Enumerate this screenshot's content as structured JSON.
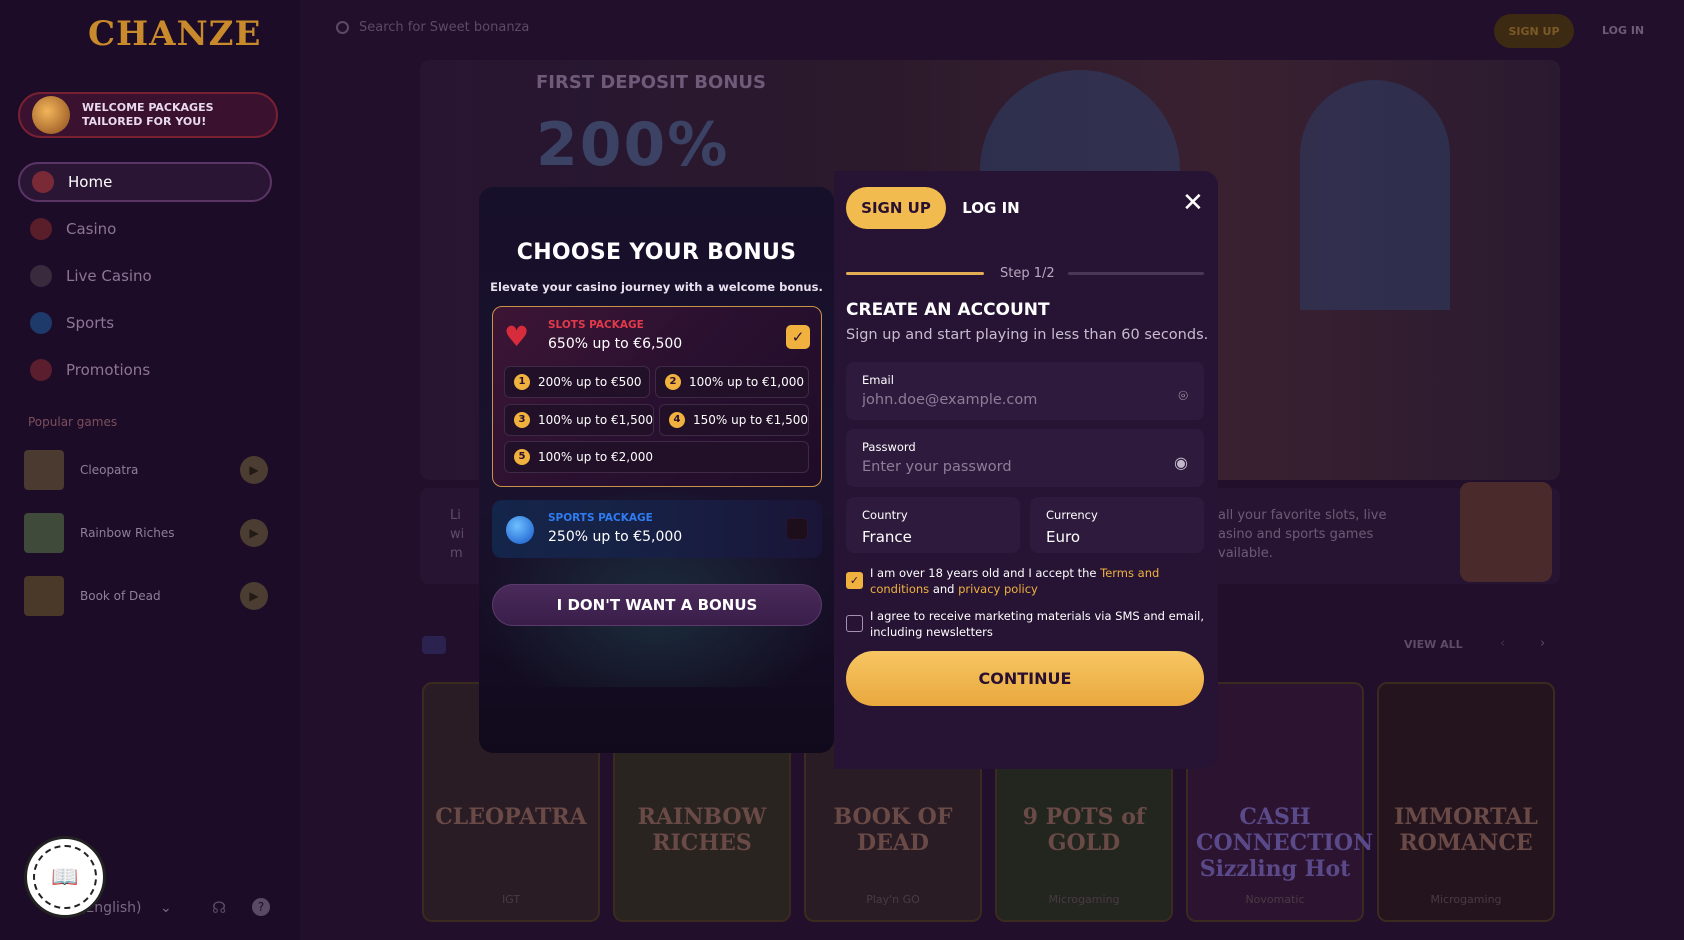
{
  "app": {
    "logo": "CHANZE",
    "search_placeholder": "Search for Sweet bonanza",
    "signup_label": "SIGN UP",
    "login_label": "LOG IN"
  },
  "sidebar": {
    "welcome_text": "WELCOME PACKAGES TAILORED FOR YOU!",
    "nav": [
      {
        "label": "Home"
      },
      {
        "label": "Casino"
      },
      {
        "label": "Live Casino"
      },
      {
        "label": "Sports"
      },
      {
        "label": "Promotions"
      }
    ],
    "popular_title": "Popular games",
    "popular_games": [
      {
        "name": "Cleopatra"
      },
      {
        "name": "Rainbow Riches"
      },
      {
        "name": "Book of Dead"
      }
    ],
    "language": "(English)"
  },
  "hero": {
    "title": "FIRST DEPOSIT BONUS",
    "big": "200%",
    "info_left": "Li\nwi\nm",
    "info_right": "all your favorite slots, live\nasino and sports games\nvailable."
  },
  "games_section": {
    "view_all": "VIEW ALL",
    "tiles": [
      {
        "name": "CLEOPATRA",
        "provider": "IGT"
      },
      {
        "name": "RAINBOW RICHES",
        "provider": ""
      },
      {
        "name": "BOOK OF DEAD",
        "provider": "Play'n GO"
      },
      {
        "name": "9 POTS of GOLD",
        "provider": "Microgaming"
      },
      {
        "name": "CASH CONNECTION Sizzling Hot",
        "provider": "Novomatic"
      },
      {
        "name": "IMMORTAL ROMANCE",
        "provider": "Microgaming"
      }
    ]
  },
  "bonus": {
    "title": "CHOOSE YOUR BONUS",
    "subtitle": "Elevate your casino journey with a welcome bonus.",
    "slots": {
      "label": "SLOTS PACKAGE",
      "value": "650% up to €6,500",
      "selected": true,
      "options": [
        {
          "num": "1",
          "text": "200% up to €500"
        },
        {
          "num": "2",
          "text": "100% up to €1,000"
        },
        {
          "num": "3",
          "text": "100% up to €1,500"
        },
        {
          "num": "4",
          "text": "150% up to €1,500"
        },
        {
          "num": "5",
          "text": "100% up to €2,000"
        }
      ]
    },
    "sports": {
      "label": "SPORTS PACKAGE",
      "value": "250% up to €5,000",
      "selected": false
    },
    "no_bonus_label": "I DON'T WANT A BONUS"
  },
  "auth": {
    "tab_signup": "SIGN UP",
    "tab_login": "LOG IN",
    "step": "Step 1/2",
    "progress": 0.5,
    "title": "CREATE AN ACCOUNT",
    "subtitle": "Sign up and start playing in less than 60 seconds.",
    "email_label": "Email",
    "email_placeholder": "john.doe@example.com",
    "password_label": "Password",
    "password_placeholder": "Enter your password",
    "country_label": "Country",
    "country_value": "France",
    "currency_label": "Currency",
    "currency_value": "Euro",
    "terms_1": "I am over 18 years old and I accept the ",
    "terms_link": "Terms and conditions",
    "terms_and": " and ",
    "privacy_link": "privacy policy",
    "terms_checked": true,
    "marketing": "I agree to receive marketing materials via SMS and email, including newsletters",
    "marketing_checked": false,
    "continue_label": "CONTINUE"
  },
  "badge": {
    "text": "BOOK OF BONUS"
  },
  "colors": {
    "accent_gold": "#f0b13e",
    "slots_red": "#e23a4b",
    "sports_blue": "#2f7cf0",
    "modal_bg": "#271434"
  },
  "icons": {
    "search": "search-icon",
    "close": "close-icon",
    "face_scan": "face-scan-icon",
    "eye": "eye-icon",
    "heart": "heart-icon",
    "ball": "sports-ball-icon",
    "check": "check-icon"
  }
}
